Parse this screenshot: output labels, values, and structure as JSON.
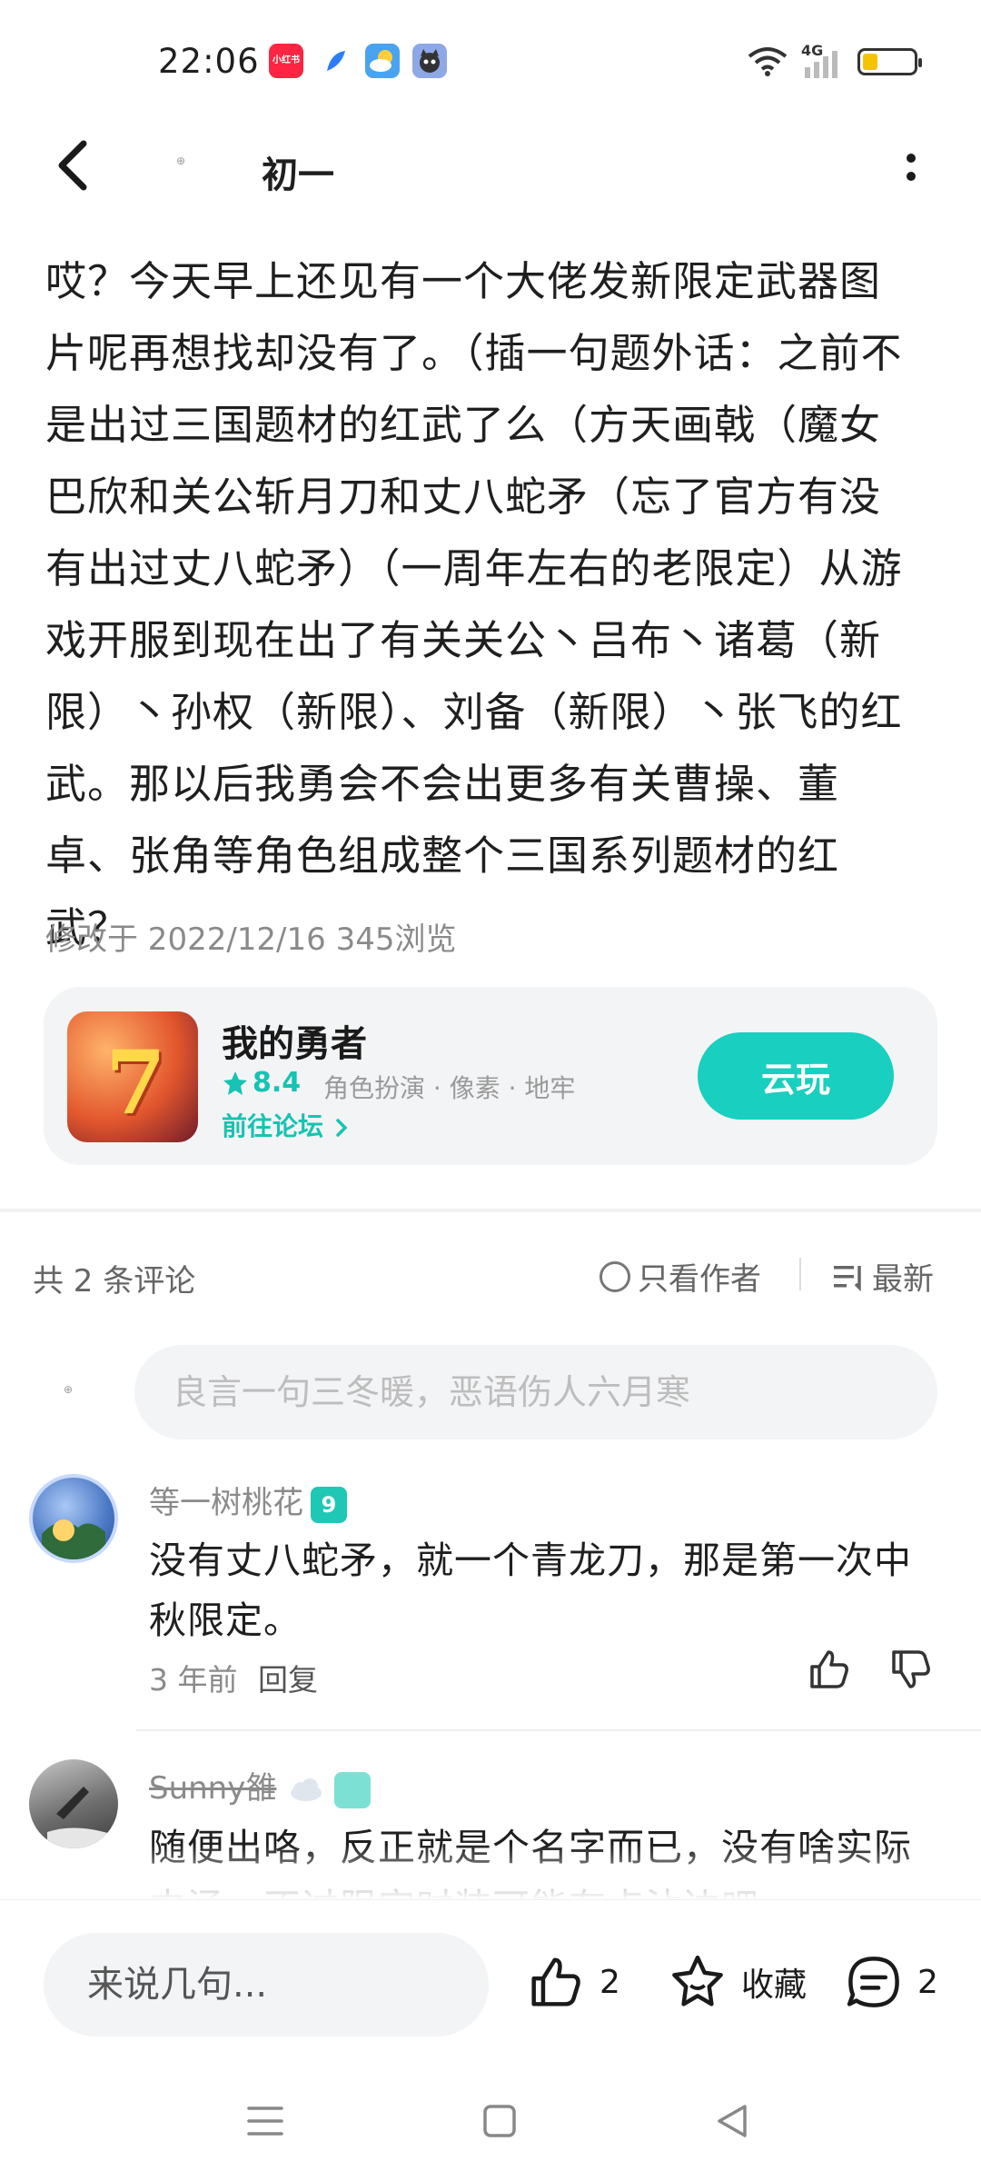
{
  "status_bar": {
    "time": "22:06",
    "app_icons": [
      "xiaohongshu-icon",
      "feather-app-icon",
      "weather-icon",
      "cat-app-icon"
    ],
    "app_icon_label": "小红书",
    "network": "4G",
    "icons": [
      "wifi-icon",
      "signal-icon",
      "battery-icon"
    ]
  },
  "header": {
    "title": "初一",
    "avatar_text": "⊕"
  },
  "article": {
    "body": "哎？今天早上还见有一个大佬发新限定武器图片呢再想找却没有了。（插一句题外话：之前不是出过三国题材的红武了么（方天画戟（魔女巴欣和关公斩月刀和丈八蛇矛（忘了官方有没有出过丈八蛇矛）（一周年左右的老限定）从游戏开服到现在出了有关关公丶吕布丶诸葛（新限）丶孙权（新限）、刘备（新限）丶张飞的红武。那以后我勇会不会出更多有关曹操、董卓、张角等角色组成整个三国系列题材的红武？",
    "edited": "修改于 2022/12/16  345浏览"
  },
  "game_card": {
    "name": "我的勇者",
    "rating": "8.4",
    "tags": "角色扮演 · 像素 · 地牢",
    "forum_link": "前往论坛",
    "play_button": "云玩",
    "icon_glyph": "7"
  },
  "comments_bar": {
    "count": "共 2 条评论",
    "only_author": "只看作者",
    "sort": "最新"
  },
  "comment_input": {
    "placeholder": "良言一句三冬暖，恶语伤人六月寒",
    "avatar_text": "⊕"
  },
  "comments": [
    {
      "username": "等一树桃花",
      "level": "9",
      "text": "没有丈八蛇矛，就一个青龙刀，那是第一次中秋限定。",
      "time": "3 年前",
      "reply": "回复"
    },
    {
      "username": "Sunny雒",
      "text": "随便出咯，反正就是个名字而已，没有啥实际内涵，不过限定时装可能有点沾边吧"
    }
  ],
  "bottom_bar": {
    "input_placeholder": "来说几句...",
    "like_count": "2",
    "favorite_label": "收藏",
    "comment_count": "2"
  },
  "colors": {
    "accent": "#19cfbf",
    "text": "#1f1f1f",
    "muted": "#8a8a8a",
    "card_bg": "#f3f4f6"
  }
}
